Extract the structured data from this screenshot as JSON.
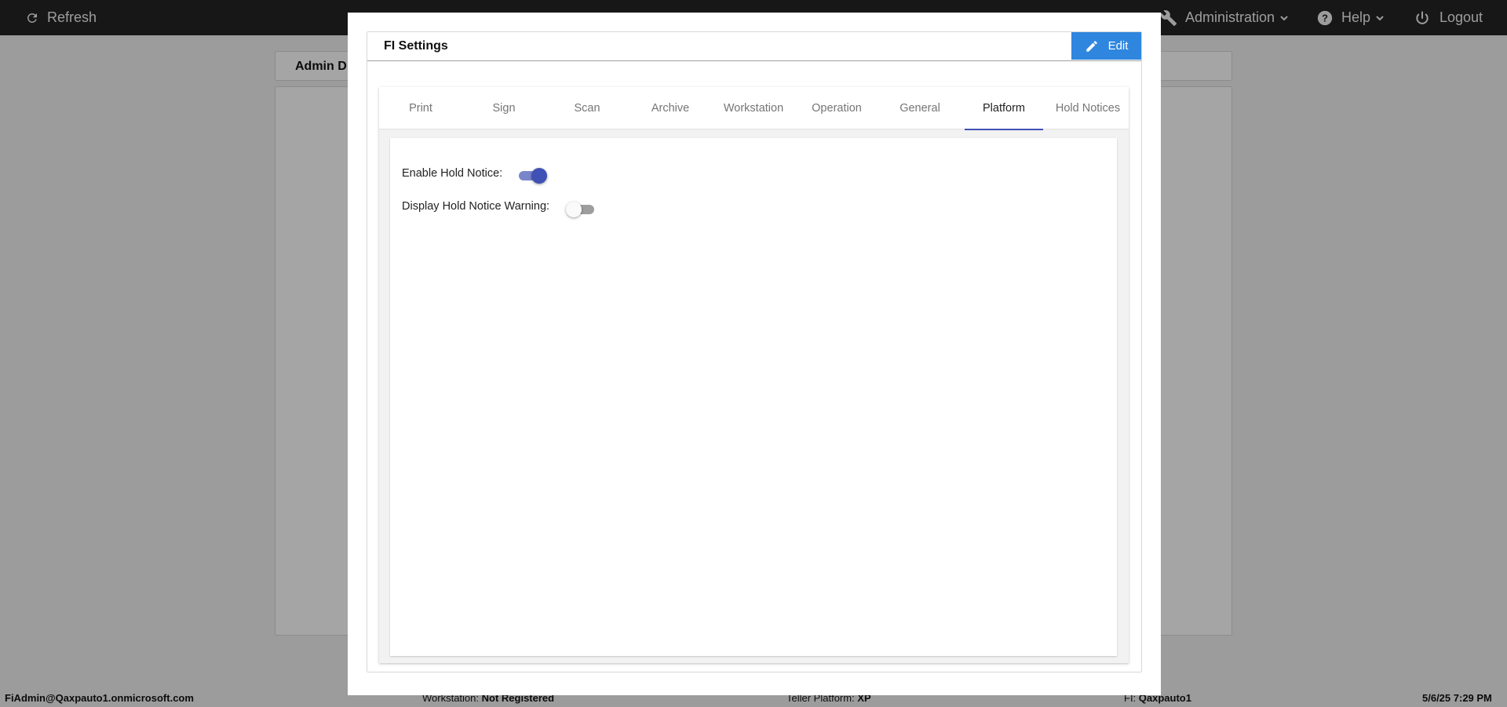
{
  "topbar": {
    "refresh_label": "Refresh",
    "administration_label": "Administration",
    "help_label": "Help",
    "logout_label": "Logout"
  },
  "background": {
    "header_title": "Admin D"
  },
  "statusbar": {
    "user": "FiAdmin@Qaxpauto1.onmicrosoft.com",
    "workstation_label": "Workstation:",
    "workstation_value": "Not Registered",
    "teller_platform_label": "Teller Platform:",
    "teller_platform_value": "XP",
    "fi_label": "FI:",
    "fi_value": "Qaxpauto1",
    "datetime": "5/6/25 7:29 PM"
  },
  "modal": {
    "title": "FI Settings",
    "edit_label": "Edit",
    "tabs": [
      {
        "label": "Print"
      },
      {
        "label": "Sign"
      },
      {
        "label": "Scan"
      },
      {
        "label": "Archive"
      },
      {
        "label": "Workstation"
      },
      {
        "label": "Operation"
      },
      {
        "label": "General"
      },
      {
        "label": "Platform"
      },
      {
        "label": "Hold Notices"
      }
    ],
    "active_tab": "Platform",
    "settings": {
      "enable_hold_notice": {
        "label": "Enable Hold Notice:",
        "value": true
      },
      "display_hold_notice_warning": {
        "label": "Display Hold Notice Warning:",
        "value": false
      }
    }
  },
  "colors": {
    "topbar": "#222222",
    "accent": "#3f51b5",
    "edit_button": "#2e86de"
  }
}
